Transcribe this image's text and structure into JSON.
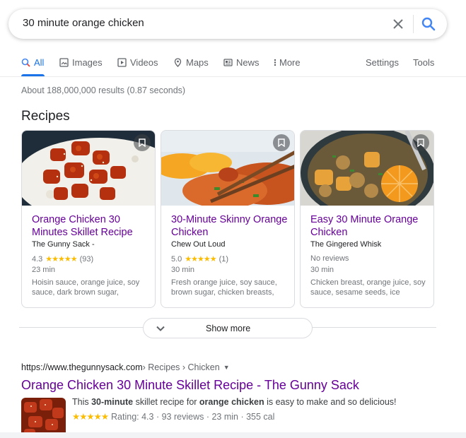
{
  "search": {
    "query": "30 minute orange chicken"
  },
  "tabs": [
    {
      "label": "All",
      "icon": "search-icon"
    },
    {
      "label": "Images",
      "icon": "image-icon"
    },
    {
      "label": "Videos",
      "icon": "play-icon"
    },
    {
      "label": "Maps",
      "icon": "map-pin-icon"
    },
    {
      "label": "News",
      "icon": "news-icon"
    },
    {
      "label": "More",
      "icon": "more-vert-icon"
    }
  ],
  "tools": {
    "settings": "Settings",
    "tools": "Tools"
  },
  "stats": "About 188,000,000 results (0.87 seconds)",
  "recipes": {
    "heading": "Recipes",
    "cards": [
      {
        "title": "Orange Chicken 30 Minutes Skillet Recipe",
        "source": "The Gunny Sack -",
        "rating": "4.3",
        "stars": "★★★★★",
        "reviews": "(93)",
        "time": "23 min",
        "ingredients": "Hoisin sauce, orange juice, soy sauce, dark brown sugar,"
      },
      {
        "title": "30-Minute Skinny Orange Chicken",
        "source": "Chew Out Loud",
        "rating": "5.0",
        "stars": "★★★★★",
        "reviews": "(1)",
        "time": "30 min",
        "ingredients": "Fresh orange juice, soy sauce, brown sugar, chicken breasts,"
      },
      {
        "title": "Easy 30 Minute Orange Chicken",
        "source": "The Gingered Whisk",
        "no_reviews": "No reviews",
        "time": "30 min",
        "ingredients": "Chicken breast, orange juice, soy sauce, sesame seeds, ice"
      }
    ],
    "show_more": "Show more"
  },
  "result": {
    "url_domain": "https://www.thegunnysack.com",
    "url_path": " › Recipes › Chicken",
    "title": "Orange Chicken 30 Minute Skillet Recipe - The Gunny Sack",
    "snippet_parts": [
      "This ",
      "30-minute",
      " skillet recipe for ",
      "orange chicken",
      " is easy to make and so delicious!"
    ],
    "stars": "★★★★★",
    "meta": "Rating: 4.3 · 93 reviews · 23 min · 355 cal"
  },
  "colors": {
    "link_visited": "#660099",
    "accent": "#1a73e8",
    "star": "#fbbc04"
  }
}
